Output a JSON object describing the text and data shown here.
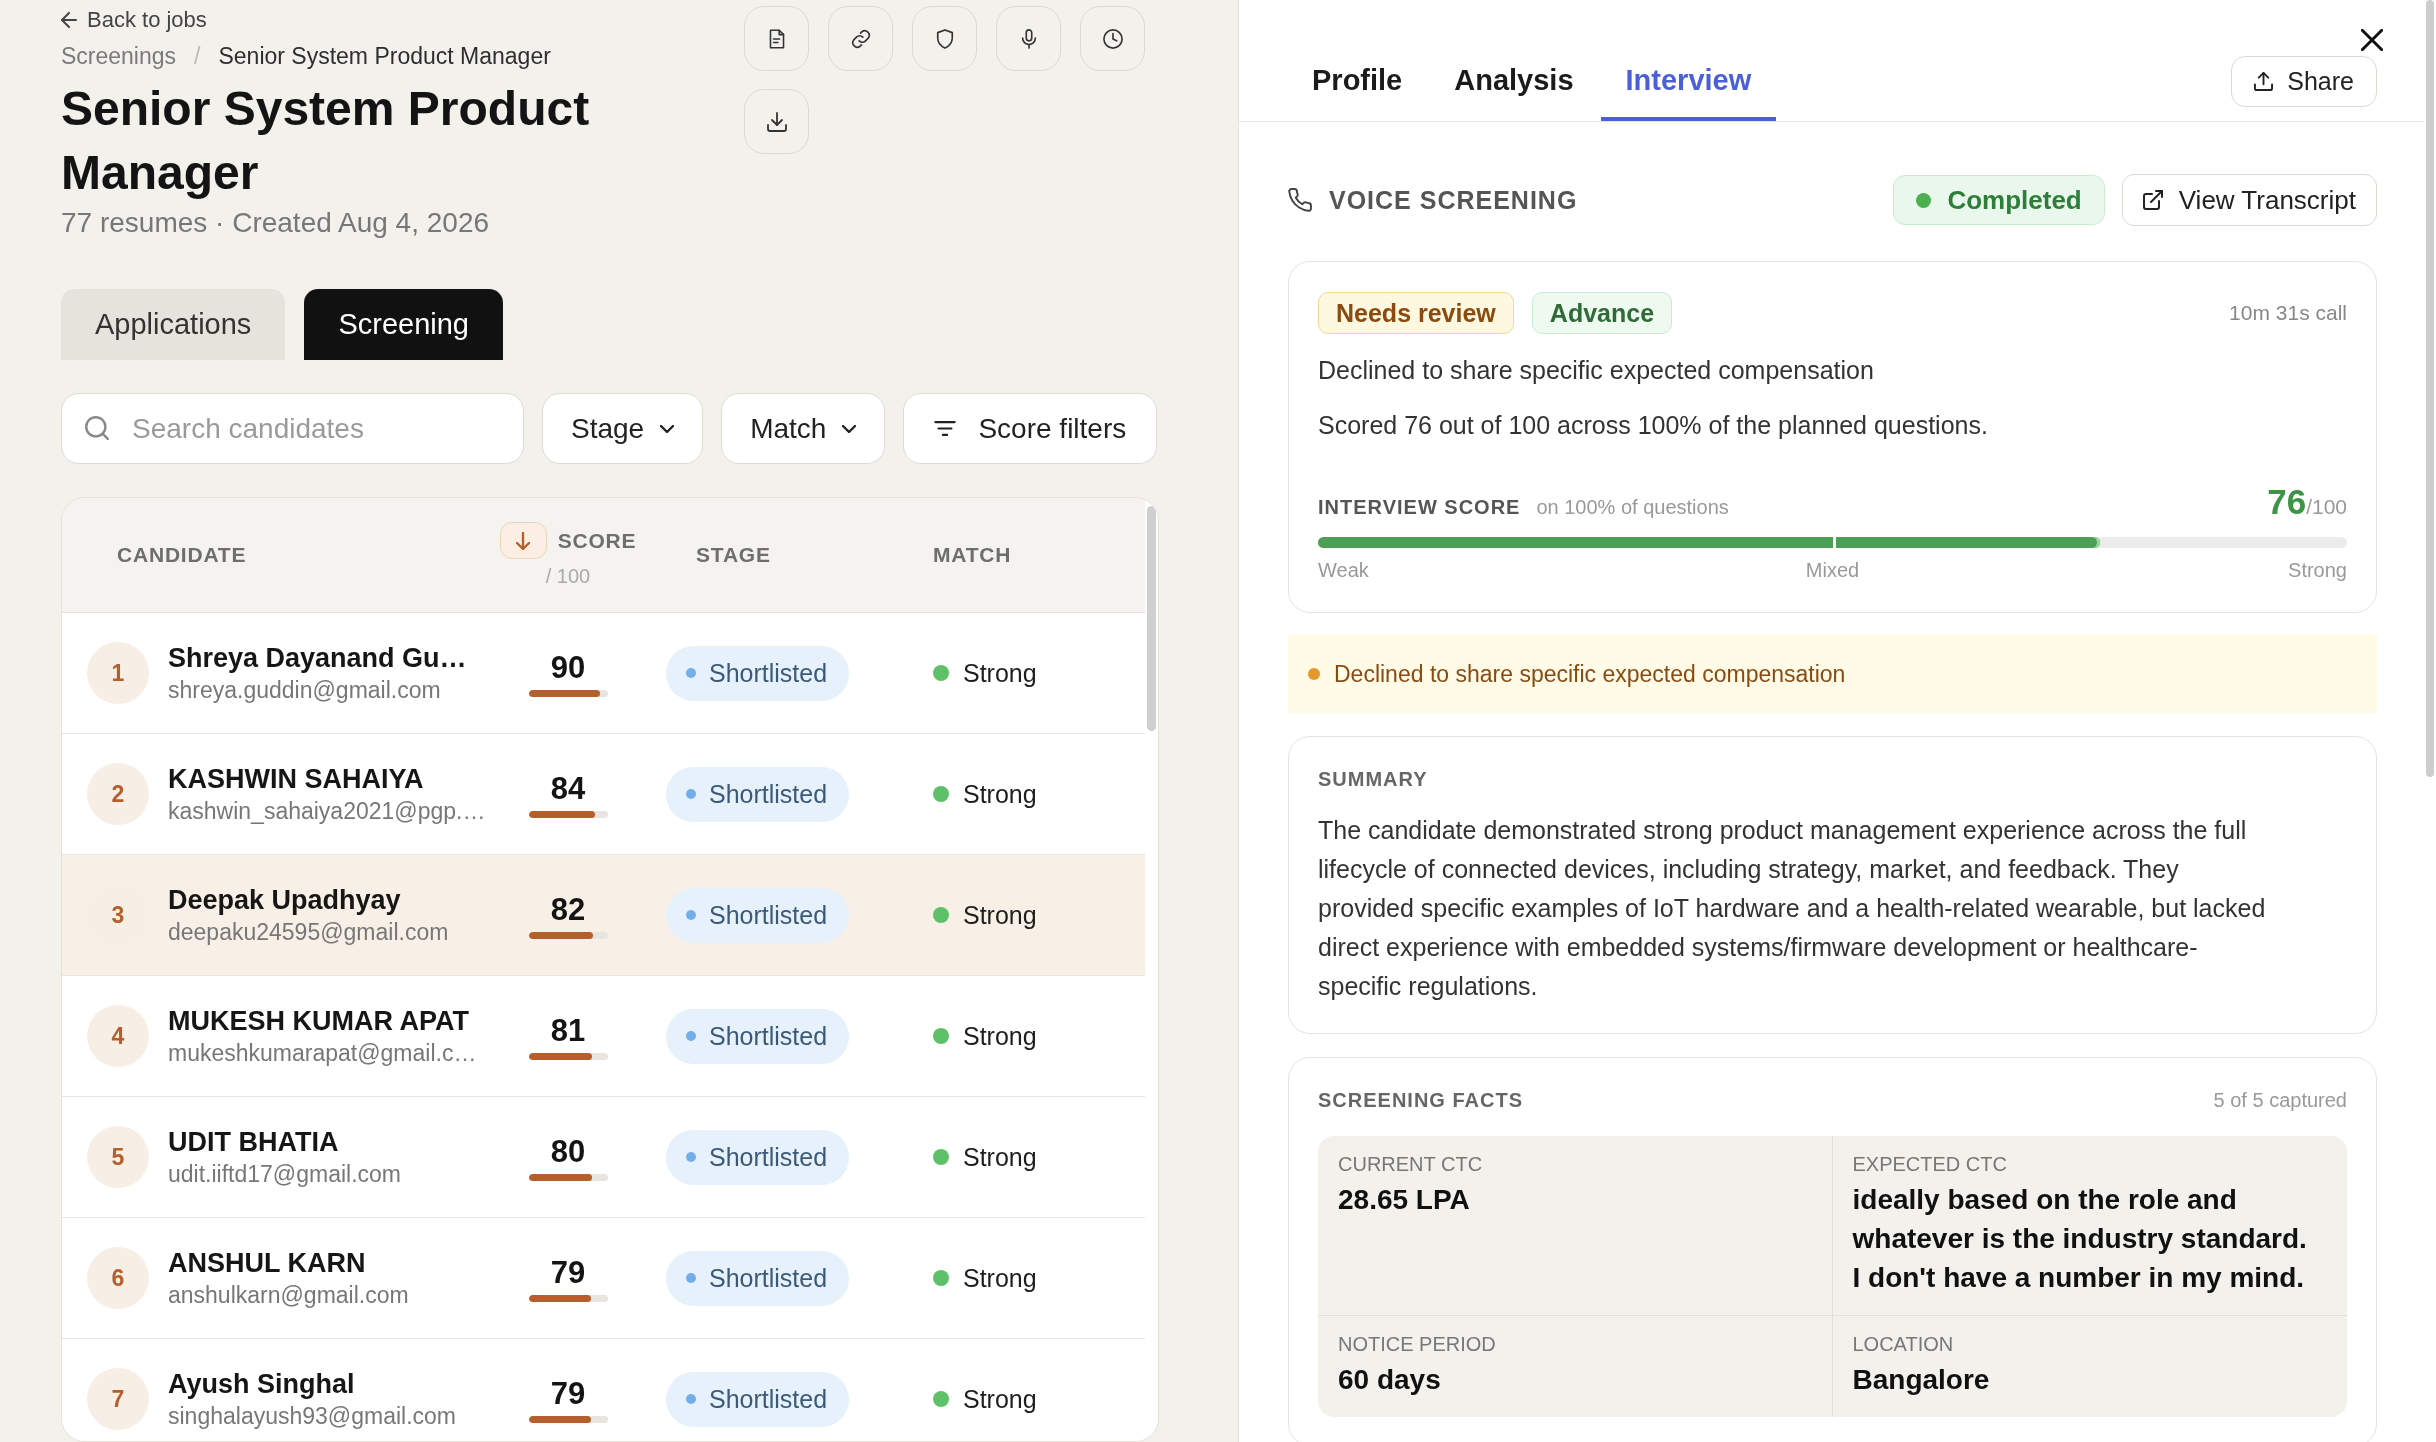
{
  "back_link": {
    "label": "Back to jobs"
  },
  "breadcrumb": {
    "separator": "/",
    "items": [
      {
        "label": "Screenings",
        "current": false
      },
      {
        "label": "Senior System Product Manager",
        "current": true
      }
    ]
  },
  "job": {
    "title": "Senior System Product Manager",
    "meta": "77 resumes · Created Aug 4, 2026"
  },
  "view_tabs": [
    {
      "label": "Applications",
      "selected": false
    },
    {
      "label": "Screening",
      "selected": true
    }
  ],
  "filters": [
    {
      "kind": "search",
      "placeholder": "Search candidates"
    },
    {
      "kind": "dropdown",
      "label": "Stage"
    },
    {
      "kind": "dropdown",
      "label": "Match"
    },
    {
      "kind": "button",
      "label": "Score filters"
    }
  ],
  "table": {
    "columns": [
      {
        "label": "CANDIDATE"
      },
      {
        "label": "SCORE",
        "sub": "/ 100",
        "sorted": true
      },
      {
        "label": "STAGE"
      },
      {
        "label": "MATCH"
      }
    ],
    "rows": [
      {
        "rank": "1",
        "name": "Shreya Dayanand Gu…",
        "email": "shreya.guddin@gmail.com",
        "score": "90",
        "level": 0.9,
        "stage": {
          "label": "Shortlisted",
          "color": "#74aee8"
        },
        "match": {
          "label": "Strong",
          "color": "#5ec16a"
        },
        "selected": false
      },
      {
        "rank": "2",
        "name": "KASHWIN SAHAIYA",
        "email": "kashwin_sahaiya2021@pgp.…",
        "score": "84",
        "level": 0.84,
        "stage": {
          "label": "Shortlisted",
          "color": "#74aee8"
        },
        "match": {
          "label": "Strong",
          "color": "#5ec16a"
        },
        "selected": false
      },
      {
        "rank": "3",
        "name": "Deepak Upadhyay",
        "email": "deepaku24595@gmail.com",
        "score": "82",
        "level": 0.82,
        "stage": {
          "label": "Shortlisted",
          "color": "#74aee8"
        },
        "match": {
          "label": "Strong",
          "color": "#5ec16a"
        },
        "selected": true
      },
      {
        "rank": "4",
        "name": "MUKESH KUMAR APAT",
        "email": "mukeshkumarapat@gmail.c…",
        "score": "81",
        "level": 0.81,
        "stage": {
          "label": "Shortlisted",
          "color": "#74aee8"
        },
        "match": {
          "label": "Strong",
          "color": "#5ec16a"
        },
        "selected": false
      },
      {
        "rank": "5",
        "name": "UDIT BHATIA",
        "email": "udit.iiftd17@gmail.com",
        "score": "80",
        "level": 0.8,
        "stage": {
          "label": "Shortlisted",
          "color": "#74aee8"
        },
        "match": {
          "label": "Strong",
          "color": "#5ec16a"
        },
        "selected": false
      },
      {
        "rank": "6",
        "name": "ANSHUL KARN",
        "email": "anshulkarn@gmail.com",
        "score": "79",
        "level": 0.79,
        "stage": {
          "label": "Shortlisted",
          "color": "#74aee8"
        },
        "match": {
          "label": "Strong",
          "color": "#5ec16a"
        },
        "selected": false
      },
      {
        "rank": "7",
        "name": "Ayush Singhal",
        "email": "singhalayush93@gmail.com",
        "score": "79",
        "level": 0.79,
        "stage": {
          "label": "Shortlisted",
          "color": "#74aee8"
        },
        "match": {
          "label": "Strong",
          "color": "#5ec16a"
        },
        "selected": false
      }
    ]
  },
  "detail": {
    "tabs": [
      {
        "label": "Profile",
        "selected": false
      },
      {
        "label": "Analysis",
        "selected": false
      },
      {
        "label": "Interview",
        "selected": true
      }
    ],
    "share": {
      "label": "Share"
    },
    "voice": {
      "title": "VOICE SCREENING",
      "status": "Completed",
      "transcript": "View Transcript"
    },
    "score_card": {
      "tags": [
        {
          "label": "Needs review",
          "kind": "warning"
        },
        {
          "label": "Advance",
          "kind": "success"
        }
      ],
      "duration": "10m 31s call",
      "reason": "Declined to share specific expected compensation",
      "line": "Scored 76 out of 100 across 100% of the planned questions.",
      "score_label": "INTERVIEW SCORE",
      "score_note": "on 100% of questions",
      "score": "76",
      "score_max": "/100",
      "level": 0.76,
      "scale": [
        "Weak",
        "Mixed",
        "Strong"
      ]
    },
    "alerts": [
      {
        "kind": "warning",
        "text": "Declined to share specific expected compensation"
      }
    ],
    "summary": {
      "title": "SUMMARY",
      "text": "The candidate demonstrated strong product management experience across the full lifecycle of connected devices, including strategy, market, and feedback. They provided specific examples of IoT hardware and a health-related wearable, but lacked direct experience with embedded systems/firmware development or healthcare-specific regulations."
    },
    "facts": {
      "title": "SCREENING FACTS",
      "count": "5 of 5 captured",
      "items": [
        {
          "label": "CURRENT CTC",
          "value": "28.65 LPA"
        },
        {
          "label": "EXPECTED CTC",
          "value": "ideally based on the role and whatever is the industry standard. I don't have a number in my mind."
        },
        {
          "label": "NOTICE PERIOD",
          "value": "60 days"
        },
        {
          "label": "LOCATION",
          "value": "Bangalore"
        }
      ]
    }
  }
}
